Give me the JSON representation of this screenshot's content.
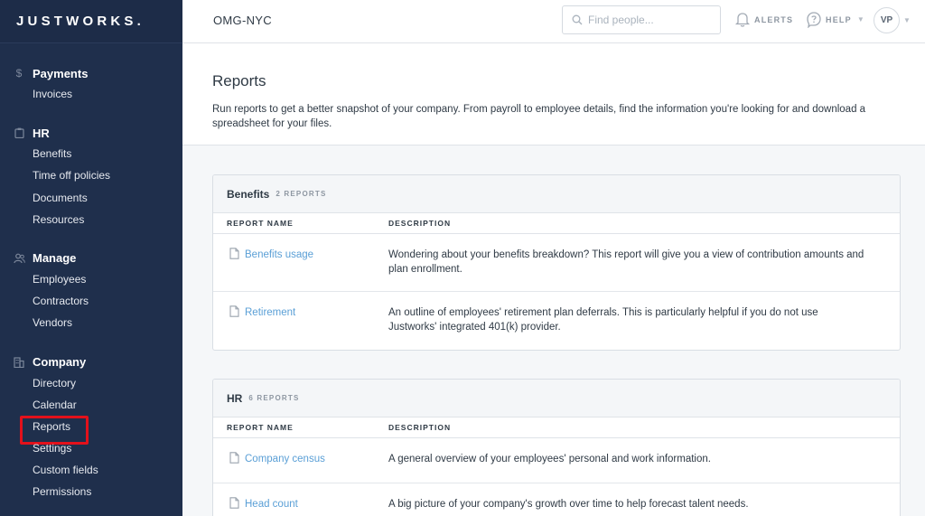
{
  "brand": {
    "logo": "JUSTWORKS."
  },
  "sidebar": {
    "sections": [
      {
        "icon": "dollar-icon",
        "label": "Payments",
        "items": [
          "Invoices"
        ]
      },
      {
        "icon": "clipboard-icon",
        "label": "HR",
        "items": [
          "Benefits",
          "Time off policies",
          "Documents",
          "Resources"
        ]
      },
      {
        "icon": "people-icon",
        "label": "Manage",
        "items": [
          "Employees",
          "Contractors",
          "Vendors"
        ]
      },
      {
        "icon": "building-icon",
        "label": "Company",
        "items": [
          "Directory",
          "Calendar",
          "Reports",
          "Settings",
          "Custom fields",
          "Permissions"
        ]
      }
    ],
    "highlighted_item": "Reports"
  },
  "header": {
    "company": "OMG-NYC",
    "search_placeholder": "Find people...",
    "alerts_label": "ALERTS",
    "help_label": "HELP",
    "avatar_initials": "VP"
  },
  "page": {
    "title": "Reports",
    "description": "Run reports to get a better snapshot of your company. From payroll to employee details, find the information you're looking for and download a spreadsheet for your files."
  },
  "cards": [
    {
      "title": "Benefits",
      "count": "2 REPORTS",
      "col_name": "REPORT NAME",
      "col_desc": "DESCRIPTION",
      "rows": [
        {
          "name": "Benefits usage",
          "description": "Wondering about your benefits breakdown? This report will give you a view of contribution amounts and plan enrollment."
        },
        {
          "name": "Retirement",
          "description": "An outline of employees' retirement plan deferrals. This is particularly helpful if you do not use Justworks' integrated 401(k) provider."
        }
      ]
    },
    {
      "title": "HR",
      "count": "6 REPORTS",
      "col_name": "REPORT NAME",
      "col_desc": "DESCRIPTION",
      "rows": [
        {
          "name": "Company census",
          "description": "A general overview of your employees' personal and work information."
        },
        {
          "name": "Head count",
          "description": "A big picture of your company's growth over time to help forecast talent needs."
        }
      ]
    }
  ],
  "colors": {
    "sidebar": "#1f2f4c",
    "link": "#5a9fd6",
    "highlight": "#e3111b"
  }
}
